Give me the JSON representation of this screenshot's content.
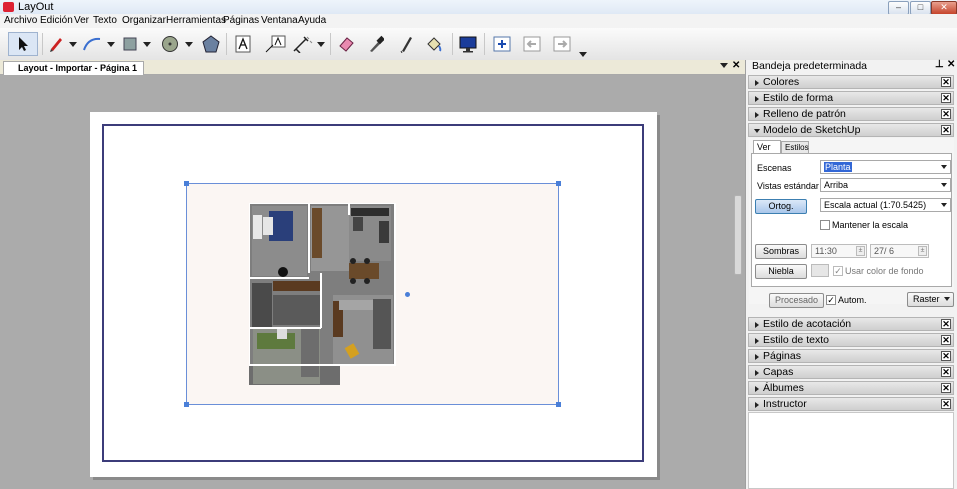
{
  "window": {
    "title": "LayOut",
    "minimize": "–",
    "maximize": "□",
    "close": "✕"
  },
  "menu": [
    "Archivo",
    "Edición",
    "Ver",
    "Texto",
    "Organizar",
    "Herramientas",
    "Páginas",
    "Ventana",
    "Ayuda"
  ],
  "toolbar": {
    "tools": [
      "select-tool-icon",
      "pencil-line-tool-icon",
      "arc-tool-icon",
      "rectangle-tool-icon",
      "circle-tool-icon",
      "polygon-tool-icon",
      "text-tool-icon",
      "label-tool-icon",
      "dimension-tool-icon",
      "eraser-tool-icon",
      "eyedropper-tool-icon",
      "split-tool-icon",
      "paint-bucket-tool-icon",
      "presentation-icon",
      "add-page-icon",
      "previous-page-icon",
      "next-page-icon"
    ]
  },
  "document": {
    "tab_label": "Layout - Importar - Página 1"
  },
  "panel": {
    "title": "Bandeja predeterminada",
    "pin": "⊥",
    "close": "✕",
    "sections_top": [
      "Colores",
      "Estilo de forma",
      "Relleno de patrón"
    ],
    "open_section": "Modelo de SketchUp",
    "tabs": [
      "Ver",
      "Estilos"
    ],
    "scenes_label": "Escenas",
    "scenes_value": "Planta",
    "views_label": "Vistas estándar",
    "views_value": "Arriba",
    "ortho_button": "Ortog.",
    "scale_value": "Escala actual (1:70.5425)",
    "keep_scale_label": "Mantener la escala",
    "shadows_button": "Sombras",
    "shadow_time": "11:30",
    "shadow_date": "27/ 6",
    "fog_button": "Niebla",
    "bg_color_label": "Usar color de fondo",
    "render_button": "Procesado",
    "auto_label": "Autom.",
    "raster_value": "Raster",
    "sections_bottom": [
      "Estilo de acotación",
      "Estilo de texto",
      "Páginas",
      "Capas",
      "Álbumes",
      "Instructor"
    ]
  },
  "colors": {
    "accent": "#4a7fd8",
    "page_border": "#3c3c7a",
    "canvas": "#ababab"
  }
}
